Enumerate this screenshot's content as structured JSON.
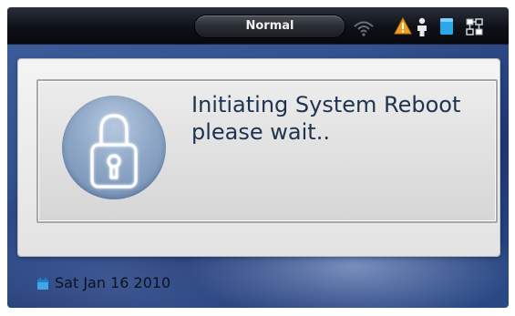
{
  "status_bar": {
    "mode_label": "Normal",
    "icons": [
      "wifi-icon",
      "warning-icon",
      "user-icon",
      "window-icon",
      "network-icon"
    ]
  },
  "dialog": {
    "icon": "lock-icon",
    "message_line1": "Initiating System Reboot",
    "message_line2": "please wait.."
  },
  "footer": {
    "icon": "calendar-icon",
    "date": "Sat Jan 16 2010"
  },
  "colors": {
    "message_text": "#1f3350",
    "lock_circle": "#8ea7c6",
    "desktop_blue": "#33528f",
    "warning_orange": "#f0a020",
    "accent_cyan": "#29a8e8"
  }
}
